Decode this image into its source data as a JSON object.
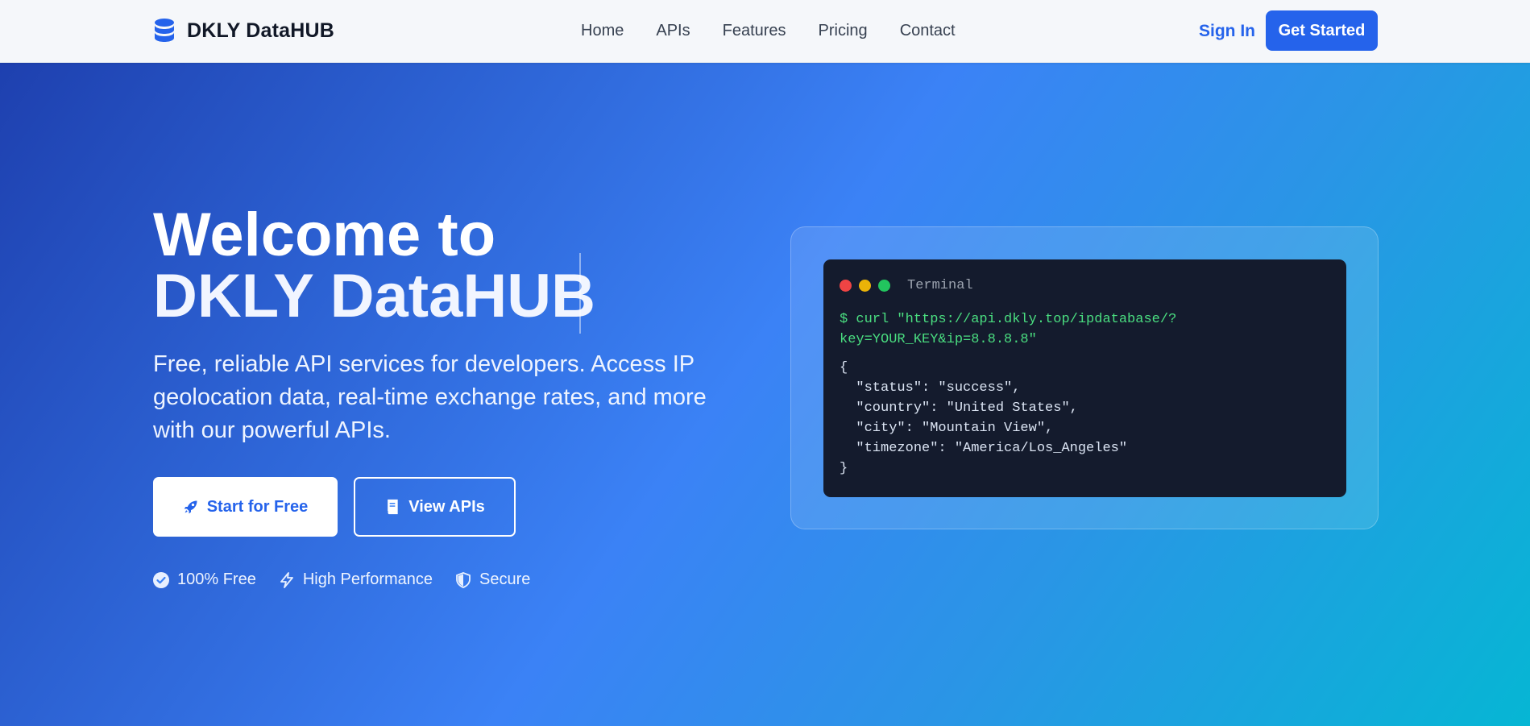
{
  "nav": {
    "brand": "DKLY DataHUB",
    "brand_icon": "database-icon",
    "links": [
      "Home",
      "APIs",
      "Features",
      "Pricing",
      "Contact"
    ],
    "signin": "Sign In",
    "get_started": "Get Started"
  },
  "hero": {
    "title_line1": "Welcome to",
    "title_line2": "DKLY DataHUB",
    "description": "Free, reliable API services for developers. Access IP geolocation data, real-time exchange rates, and more with our powerful APIs.",
    "primary_button": "Start for Free",
    "primary_icon": "rocket-icon",
    "secondary_button": "View APIs",
    "secondary_icon": "book-icon",
    "features": [
      {
        "label": "100% Free",
        "icon": "check-circle-icon"
      },
      {
        "label": "High Performance",
        "icon": "lightning-icon"
      },
      {
        "label": "Secure",
        "icon": "shield-icon"
      }
    ]
  },
  "terminal": {
    "title": "Terminal",
    "command": "$ curl \"https://api.dkly.top/ipdatabase/?key=YOUR_KEY&ip=8.8.8.8\"",
    "response": "{\n  \"status\": \"success\",\n  \"country\": \"United States\",\n  \"city\": \"Mountain View\",\n  \"timezone\": \"America/Los_Angeles\"\n}",
    "dot_colors": [
      "#ef4444",
      "#eab308",
      "#22c55e"
    ]
  },
  "colors": {
    "brand": "#2563eb",
    "hero_gradient_start": "#1e40af",
    "hero_gradient_end": "#06b6d4",
    "terminal_bg": "#141b2d",
    "command_color": "#4ade80"
  }
}
